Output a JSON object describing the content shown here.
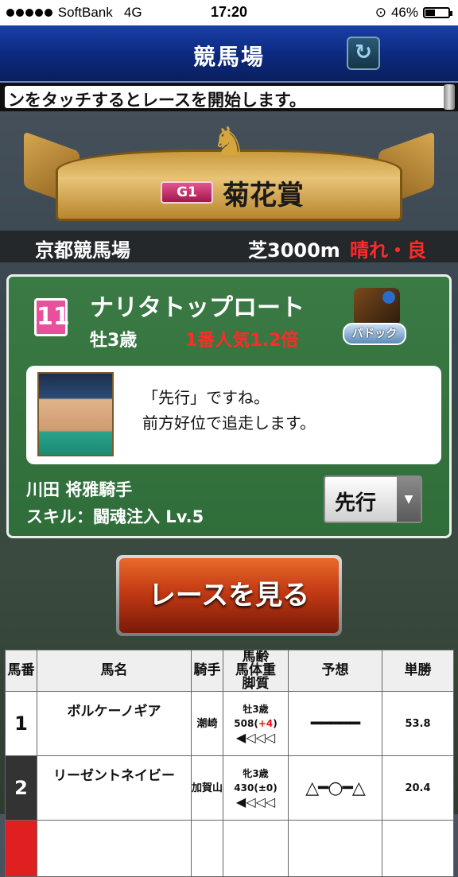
{
  "status": {
    "carrier": "SoftBank",
    "network": "4G",
    "time": "17:20",
    "battery": "46%"
  },
  "header": {
    "title": "競馬場",
    "refresh_icon": "↻"
  },
  "ticker": {
    "text": "ンをタッチするとレースを開始します。"
  },
  "race": {
    "grade": "G1",
    "name": "菊花賞",
    "venue": "京都競馬場",
    "distance": "芝3000m",
    "condition": "晴れ・良"
  },
  "horse": {
    "number": "11",
    "name": "ナリタトップロート",
    "sex_age": "牡3歳",
    "popularity": "1番人気1.2倍",
    "paddock_label": "パドック"
  },
  "comment": {
    "line1": "「先行」ですね。",
    "line2": "前方好位で追走します。"
  },
  "jockey": {
    "name": "川田 将雅騎手",
    "skill": "スキル：闘魂注入 Lv.5",
    "strategy": "先行"
  },
  "race_button": "レースを見る",
  "table": {
    "headers": {
      "num": "馬番",
      "name": "馬名",
      "jockey": "騎手",
      "info1": "馬齢",
      "info2": "馬体重",
      "info3": "脚質",
      "pred": "予想",
      "odds": "単勝"
    },
    "rows": [
      {
        "num": "1",
        "name": "ボルケーノギア",
        "jockey": "潮崎",
        "age": "牡3歳",
        "weight": "508(",
        "weight_diff": "+4",
        "weight_end": ")",
        "style": "◀◁◁◁",
        "pred": "━━━━━",
        "odds": "53.8"
      },
      {
        "num": "2",
        "name": "リーゼントネイビー",
        "jockey": "加賀山",
        "age": "牝3歳",
        "weight": "430(±0)",
        "weight_diff": "",
        "weight_end": "",
        "style": "◀◁◁◁",
        "pred": "△━○━△",
        "odds": "20.4"
      }
    ]
  }
}
